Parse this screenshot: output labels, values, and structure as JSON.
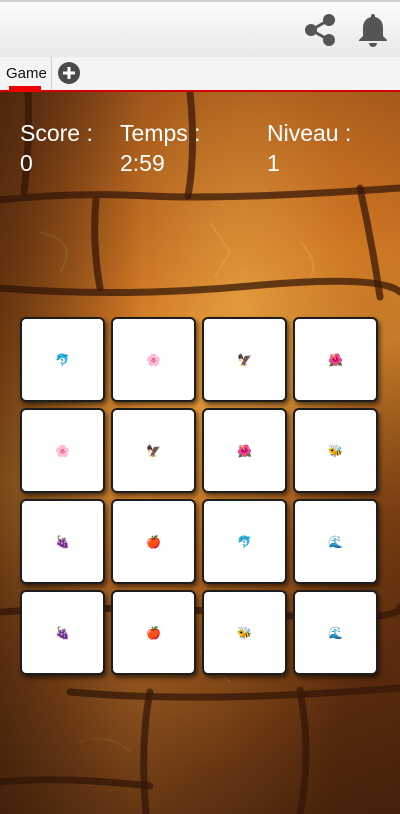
{
  "toolbar": {
    "share_icon": "share-icon",
    "notifications_icon": "bell-icon"
  },
  "tabs": [
    {
      "label": "Game",
      "active": true
    }
  ],
  "add_tab_icon": "plus-circle-icon",
  "stats": {
    "score": {
      "label": "Score :",
      "value": "0"
    },
    "time": {
      "label": "Temps :",
      "value": "2:59"
    },
    "level": {
      "label": "Niveau :",
      "value": "1"
    }
  },
  "board": {
    "columns": 4,
    "cards": [
      {
        "symbol": "🐬",
        "name": "dolphin"
      },
      {
        "symbol": "🌸",
        "name": "cherry-blossom"
      },
      {
        "symbol": "🦅",
        "name": "eagle"
      },
      {
        "symbol": "🌺",
        "name": "hibiscus"
      },
      {
        "symbol": "🌸",
        "name": "cherry-blossom"
      },
      {
        "symbol": "🦅",
        "name": "eagle"
      },
      {
        "symbol": "🌺",
        "name": "hibiscus"
      },
      {
        "symbol": "🐝",
        "name": "bee"
      },
      {
        "symbol": "🍇",
        "name": "grapes"
      },
      {
        "symbol": "🍎",
        "name": "apple"
      },
      {
        "symbol": "🐬",
        "name": "dolphin"
      },
      {
        "symbol": "🌊",
        "name": "wave"
      },
      {
        "symbol": "🍇",
        "name": "grapes"
      },
      {
        "symbol": "🍎",
        "name": "apple"
      },
      {
        "symbol": "🐝",
        "name": "bee"
      },
      {
        "symbol": "🌊",
        "name": "wave"
      }
    ]
  },
  "colors": {
    "tab_indicator": "#ee0000",
    "tab_border": "#d20000",
    "stats_text": "#ffffff",
    "icon_gray": "#4a4a4a"
  }
}
